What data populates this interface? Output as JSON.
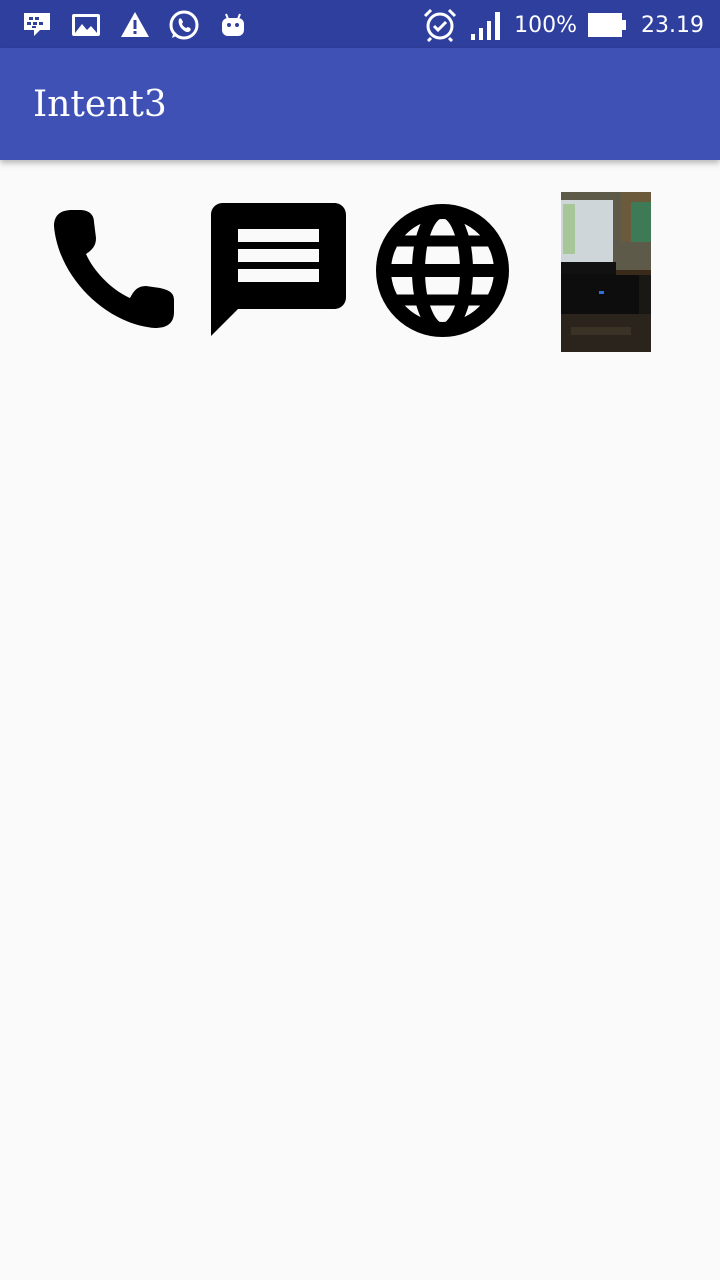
{
  "status_bar": {
    "notification_icons": [
      "bbm-icon",
      "gallery-icon",
      "warning-icon",
      "whatsapp-icon",
      "android-icon"
    ],
    "system_icons": [
      "alarm-icon",
      "signal-icon",
      "battery-icon"
    ],
    "battery_percent": "100%",
    "clock": "23.19",
    "background": "#2f3f9e"
  },
  "app_bar": {
    "title": "Intent3",
    "background": "#3f51b5"
  },
  "actions": [
    {
      "name": "phone-call-button",
      "icon": "phone-icon"
    },
    {
      "name": "sms-button",
      "icon": "message-icon"
    },
    {
      "name": "web-browser-button",
      "icon": "globe-icon"
    },
    {
      "name": "camera-photo-button",
      "icon": "photo-thumbnail"
    }
  ]
}
